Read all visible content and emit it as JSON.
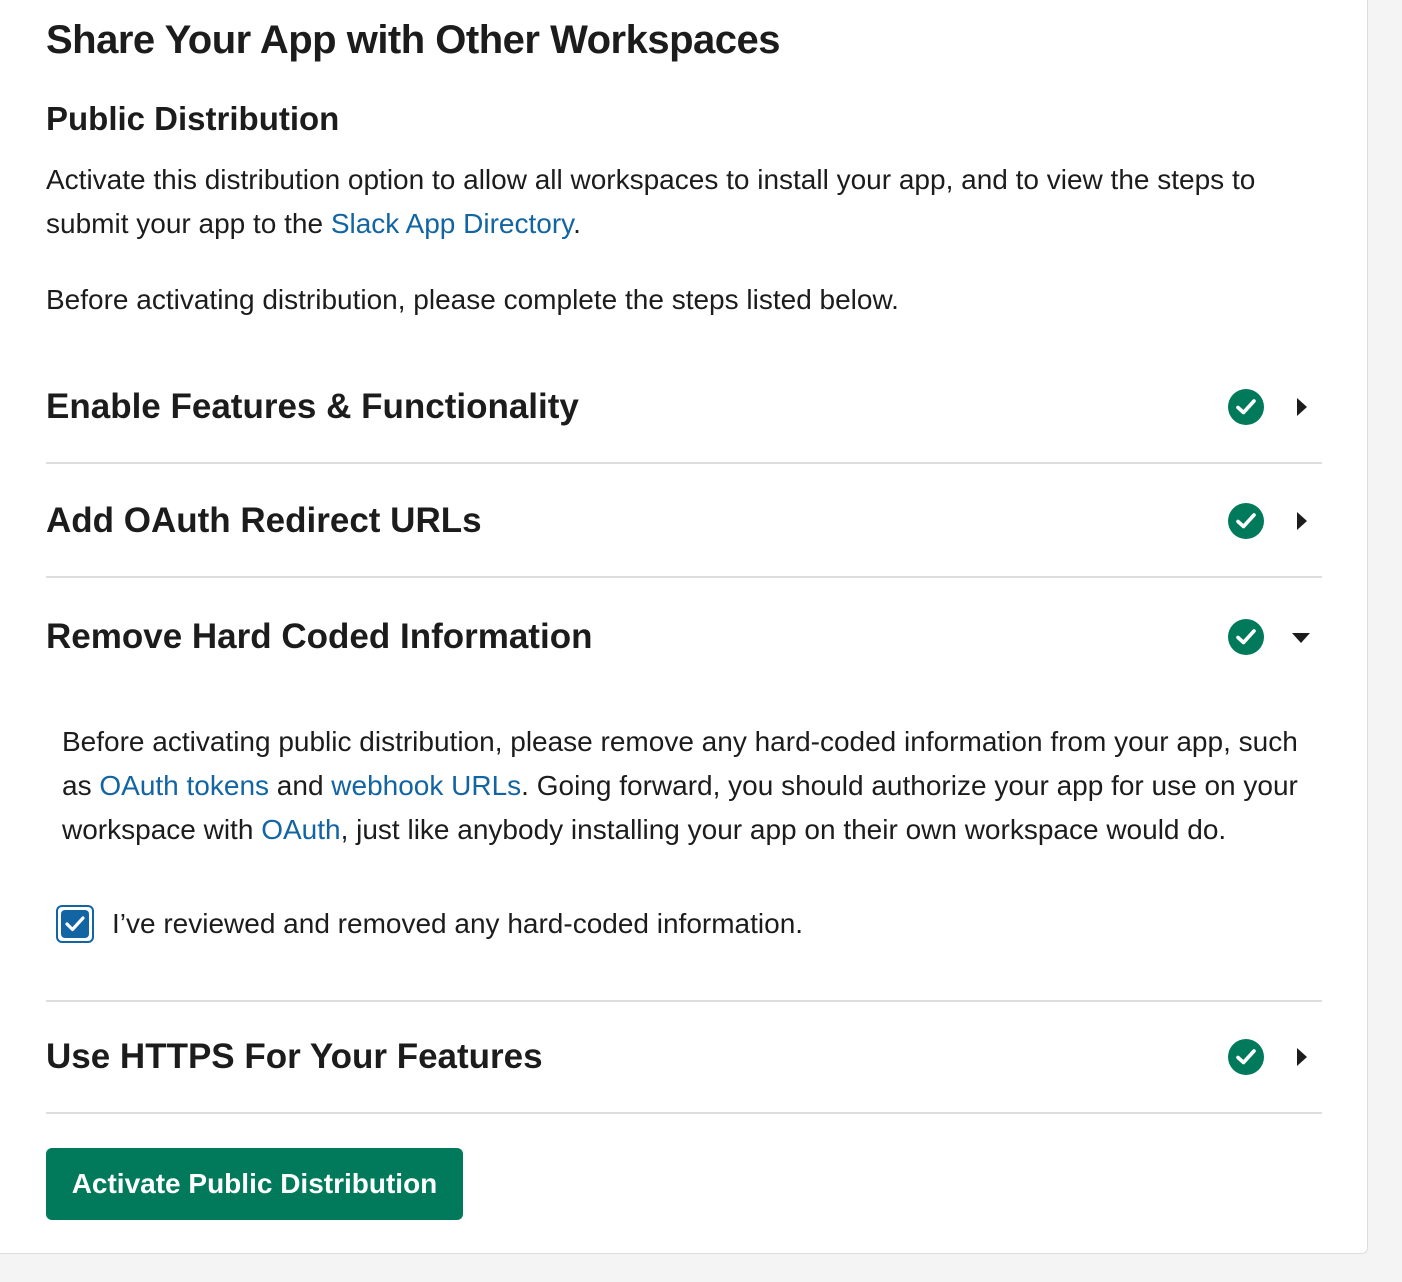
{
  "page": {
    "title": "Share Your App with Other Workspaces"
  },
  "distribution": {
    "title": "Public Distribution",
    "intro_text": "Activate this distribution option to allow all workspaces to install your app, and to view the steps to submit your app to the ",
    "intro_link": "Slack App Directory",
    "intro_end": ".",
    "before_text": "Before activating distribution, please complete the steps listed below."
  },
  "steps": [
    {
      "title": "Enable Features & Functionality",
      "completed": true,
      "expanded": false
    },
    {
      "title": "Add OAuth Redirect URLs",
      "completed": true,
      "expanded": false
    },
    {
      "title": "Remove Hard Coded Information",
      "completed": true,
      "expanded": true,
      "body": {
        "text1": "Before activating public distribution, please remove any hard-coded information from your app, such as ",
        "link1": "OAuth tokens",
        "text2": " and ",
        "link2": "webhook URLs",
        "text3": ". Going forward, you should authorize your app for use on your workspace with ",
        "link3": "OAuth",
        "text4": ", just like anybody installing your app on their own workspace would do."
      },
      "checkbox": {
        "label": "I’ve reviewed and removed any hard-coded information.",
        "checked": true
      }
    },
    {
      "title": "Use HTTPS For Your Features",
      "completed": true,
      "expanded": false
    }
  ],
  "actions": {
    "activate_label": "Activate Public Distribution"
  },
  "icons": {
    "step_status": "check-circle-icon",
    "collapsed": "caret-right-icon",
    "expanded": "caret-down-icon"
  },
  "colors": {
    "accent_green": "#007a5a",
    "link_blue": "#1264a3",
    "text": "#1d1c1d",
    "divider": "#dddddd"
  }
}
